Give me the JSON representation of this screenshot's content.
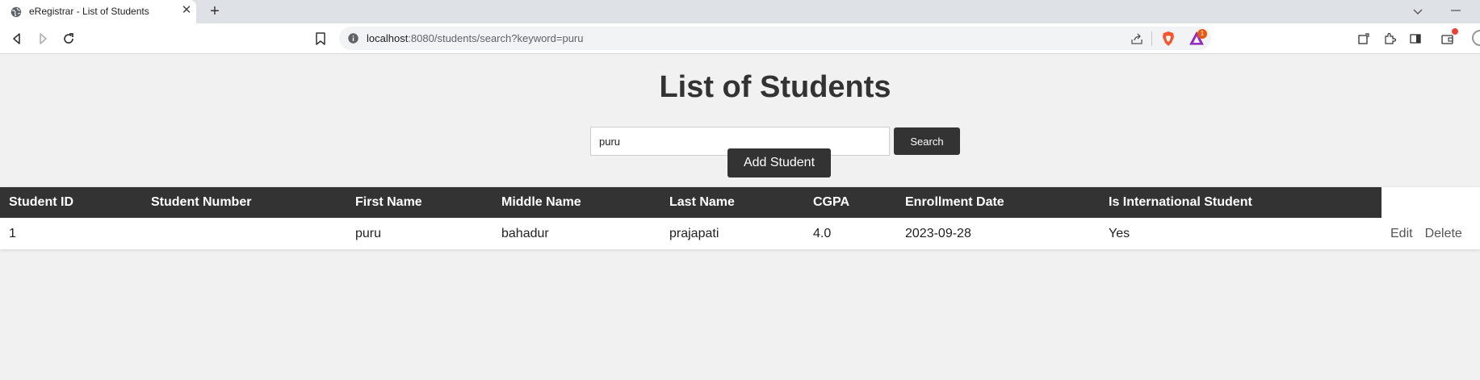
{
  "browser": {
    "tab_title": "eRegistrar - List of Students",
    "tab_close": "✕",
    "new_tab": "+",
    "url_host": "localhost",
    "url_path": ":8080/students/search?keyword=puru",
    "rewards_count": "1"
  },
  "page": {
    "title": "List of Students"
  },
  "search": {
    "value": "puru",
    "button_label": "Search"
  },
  "add_student_label": "Add Student",
  "table": {
    "headers": [
      "Student ID",
      "Student Number",
      "First Name",
      "Middle Name",
      "Last Name",
      "CGPA",
      "Enrollment Date",
      "Is International Student"
    ],
    "rows": [
      {
        "student_id": "1",
        "student_number": "",
        "first_name": "puru",
        "middle_name": "bahadur",
        "last_name": "prajapati",
        "cgpa": "4.0",
        "enrollment_date": "2023-09-28",
        "is_international": "Yes",
        "edit_label": "Edit",
        "delete_label": "Delete"
      }
    ]
  },
  "colors": {
    "accent_dark": "#333333",
    "page_bg": "#f1f1f1",
    "brave_orange": "#fb542b"
  }
}
